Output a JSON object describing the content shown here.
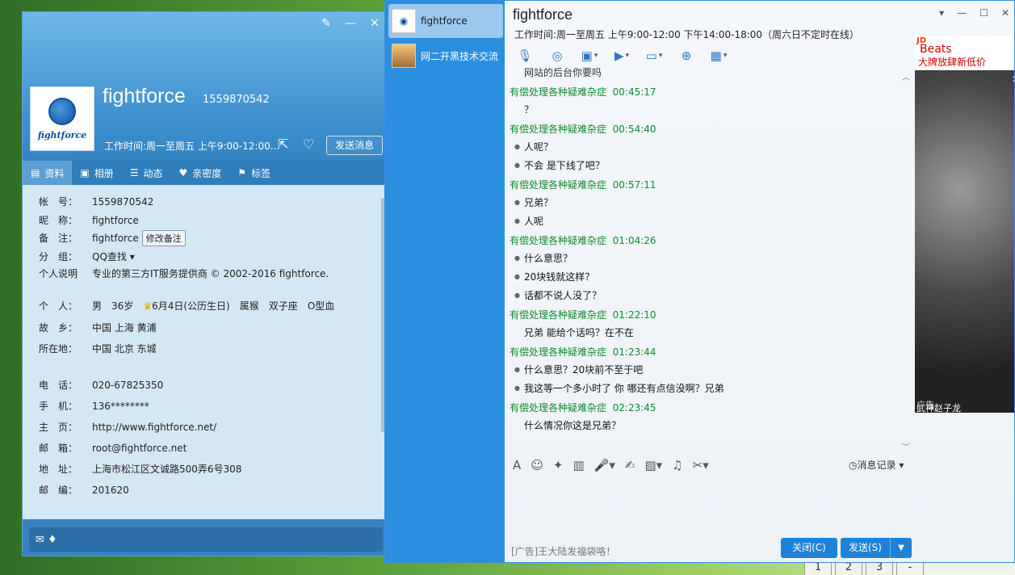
{
  "profile": {
    "name": "fightforce",
    "qq": "1559870542",
    "avatar_logo_text": "fightforce",
    "work_hours_short": "工作时间:周一至周五 上午9:00-12:00...",
    "send_message": "发送消息",
    "tabs": [
      {
        "label": "资料",
        "icon": "id-card-icon"
      },
      {
        "label": "相册",
        "icon": "photo-icon"
      },
      {
        "label": "动态",
        "icon": "list-icon"
      },
      {
        "label": "亲密度",
        "icon": "heart-icon"
      },
      {
        "label": "标签",
        "icon": "bookmark-icon"
      }
    ],
    "fields": {
      "account_label": "帐　号：",
      "account": "1559870542",
      "nickname_label": "昵　称：",
      "nickname": "fightforce",
      "remark_label": "备　注：",
      "remark": "fightforce",
      "edit_remark": "修改备注",
      "group_label": "分　组：",
      "group": "QQ查找",
      "intro_label": "个人说明",
      "intro": "专业的第三方IT服务提供商 © 2002-2016 fightforce.",
      "personal_label": "个　人：",
      "gender": "男",
      "age": "36岁",
      "birthday": "6月4日(公历生日)",
      "zodiac": "属猴",
      "constellation": "双子座",
      "blood": "O型血",
      "hometown_label": "故　乡：",
      "hometown": "中国 上海 黄浦",
      "location_label": "所在地：",
      "location": "中国 北京 东城",
      "phone_label": "电　话：",
      "phone": "020-67825350",
      "mobile_label": "手　机：",
      "mobile": "136********",
      "homepage_label": "主　页：",
      "homepage": "http://www.fightforce.net/",
      "email_label": "邮　箱：",
      "email": "root@fightforce.net",
      "address_label": "地　址：",
      "address": "上海市松江区文诚路500弄6号308",
      "zip_label": "邮　编：",
      "zip": "201620"
    }
  },
  "chat": {
    "title": "fightforce",
    "work_hours": "工作时间:周一至周五 上午9:00-12:00 下午14:00-18:00（周六日不定时在线）",
    "contacts": [
      {
        "name": "fightforce"
      },
      {
        "name": "网二开黑技术交流"
      }
    ],
    "messages": [
      {
        "sender": "有偿处理各种疑难杂症",
        "time": "00:45:17",
        "lines": [
          "？"
        ]
      },
      {
        "sender": "有偿处理各种疑难杂症",
        "time": "00:54:40",
        "lines": [
          "人呢？",
          "不会  是下线了吧？"
        ]
      },
      {
        "sender": "有偿处理各种疑难杂症",
        "time": "00:57:11",
        "lines": [
          "兄弟？",
          "人呢"
        ]
      },
      {
        "sender": "有偿处理各种疑难杂症",
        "time": "01:04:26",
        "lines": [
          "什么意思？",
          "20块钱就这样？",
          "话都不说人没了？"
        ]
      },
      {
        "sender": "有偿处理各种疑难杂症",
        "time": "01:22:10",
        "lines": [
          "兄弟    能给个话吗？在不在"
        ]
      },
      {
        "sender": "有偿处理各种疑难杂症",
        "time": "01:23:44",
        "lines": [
          "什么意思？20块前不至于吧",
          "我这等一个多小时了    你  哪还有点信没啊？兄弟"
        ]
      },
      {
        "sender": "有偿处理各种疑难杂症",
        "time": "02:23:45",
        "lines": [
          "什么情况你这是兄弟？"
        ]
      }
    ],
    "partial_top_line": "网站的后台你要吗",
    "history": "消息记录",
    "ad_line": "[广告]王大陆发福袋咯！",
    "close_btn": "关闭(C)",
    "send_btn": "发送(S)",
    "ad": {
      "jd": "JD",
      "beats": "Beats",
      "slogan": "大牌放肆新低价",
      "label": "广告",
      "caption": "武神赵子龙"
    }
  },
  "keys": [
    "1",
    "2",
    "3",
    "-"
  ]
}
